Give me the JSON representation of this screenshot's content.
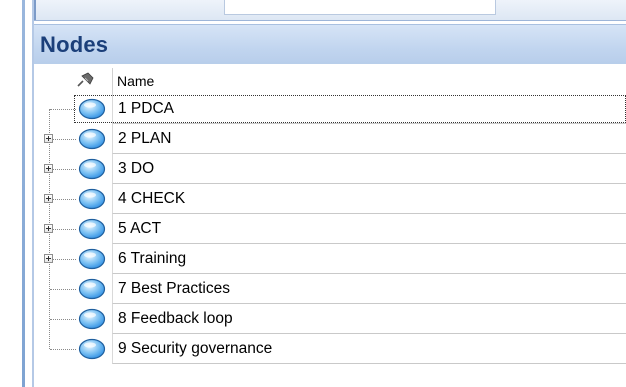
{
  "panel": {
    "title": "Nodes"
  },
  "columns": {
    "name": "Name"
  },
  "nodes": [
    {
      "label": "1 PDCA",
      "expandable": false,
      "selected": true
    },
    {
      "label": "2 PLAN",
      "expandable": true
    },
    {
      "label": "3 DO",
      "expandable": true
    },
    {
      "label": "4 CHECK",
      "expandable": true
    },
    {
      "label": "5 ACT",
      "expandable": true
    },
    {
      "label": "6 Training",
      "expandable": true
    },
    {
      "label": "7 Best Practices",
      "expandable": false
    },
    {
      "label": "8 Feedback loop",
      "expandable": false
    },
    {
      "label": "9 Security governance",
      "expandable": false
    }
  ],
  "icons": {
    "pin": "pin-icon",
    "node": "node-globe-icon",
    "expander": "plus-expander-icon"
  },
  "colors": {
    "header_bg": "#c1d5ef",
    "title": "#1b3f7a",
    "node_icon": "#2b8de3"
  }
}
